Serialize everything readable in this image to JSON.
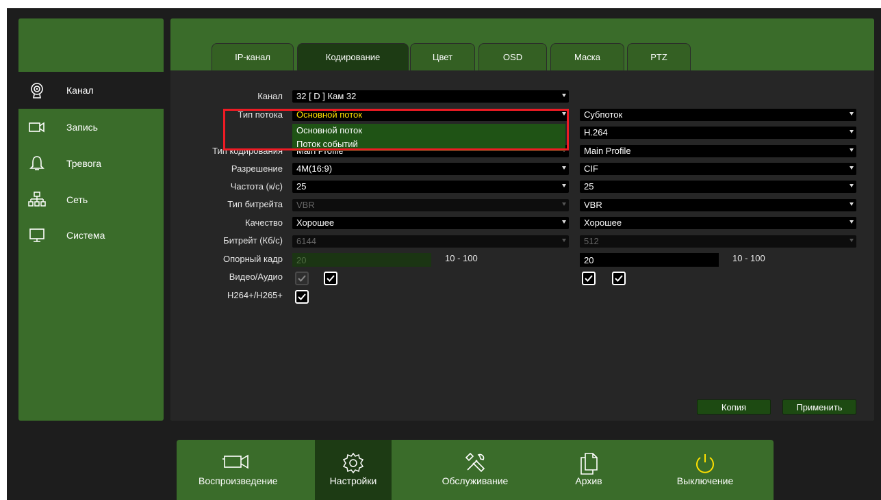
{
  "colors": {
    "accent": "#3a6c2a",
    "active": "#1d3b14",
    "highlight": "#ffe000",
    "annotation": "#ee1b24"
  },
  "sidebar": {
    "items": [
      {
        "label": "Канал",
        "icon": "camera-lens-icon"
      },
      {
        "label": "Запись",
        "icon": "video-camera-icon"
      },
      {
        "label": "Тревога",
        "icon": "bell-icon"
      },
      {
        "label": "Сеть",
        "icon": "network-icon"
      },
      {
        "label": "Система",
        "icon": "monitor-icon"
      }
    ],
    "active_index": 0
  },
  "tabs": [
    {
      "label": "IP-канал"
    },
    {
      "label": "Кодирование"
    },
    {
      "label": "Цвет"
    },
    {
      "label": "OSD"
    },
    {
      "label": "Маска"
    },
    {
      "label": "PTZ"
    }
  ],
  "active_tab": 1,
  "form": {
    "labels": {
      "channel": "Канал",
      "stream_type": "Тип потока",
      "encoding_type": "Тип кодирования",
      "resolution": "Разрешение",
      "frame_rate": "Частота (к/с)",
      "bitrate_type": "Тип битрейта",
      "quality": "Качество",
      "bitrate": "Битрейт (Кб/с)",
      "keyframe": "Опорный кадр",
      "video_audio": "Видео/Аудио",
      "h264plus": "H264+/H265+"
    },
    "channel": "32 [ D ] Кам 32",
    "main": {
      "stream_type": "Основной поток",
      "encoding_type": "Main Profile",
      "resolution": "4M(16:9)",
      "frame_rate": "25",
      "bitrate_type": "VBR",
      "quality": "Хорошее",
      "bitrate": "6144",
      "keyframe": "20",
      "keyframe_range": "10 - 100"
    },
    "sub": {
      "stream_type": "Субпоток",
      "codec": "H.264",
      "encoding_type": "Main Profile",
      "resolution": "CIF",
      "frame_rate": "25",
      "bitrate_type": "VBR",
      "quality": "Хорошее",
      "bitrate": "512",
      "keyframe": "20",
      "keyframe_range": "10 - 100"
    }
  },
  "dropdown": {
    "options": [
      "Основной поток",
      "Поток событий"
    ]
  },
  "buttons": {
    "copy": "Копия",
    "apply": "Применить"
  },
  "bottombar": [
    {
      "label": "Воспроизведение",
      "icon": "video-camera-icon"
    },
    {
      "label": "Настройки",
      "icon": "gear-icon"
    },
    {
      "label": "Обслуживание",
      "icon": "tools-icon"
    },
    {
      "label": "Архив",
      "icon": "copy-files-icon"
    },
    {
      "label": "Выключение",
      "icon": "power-icon"
    }
  ]
}
